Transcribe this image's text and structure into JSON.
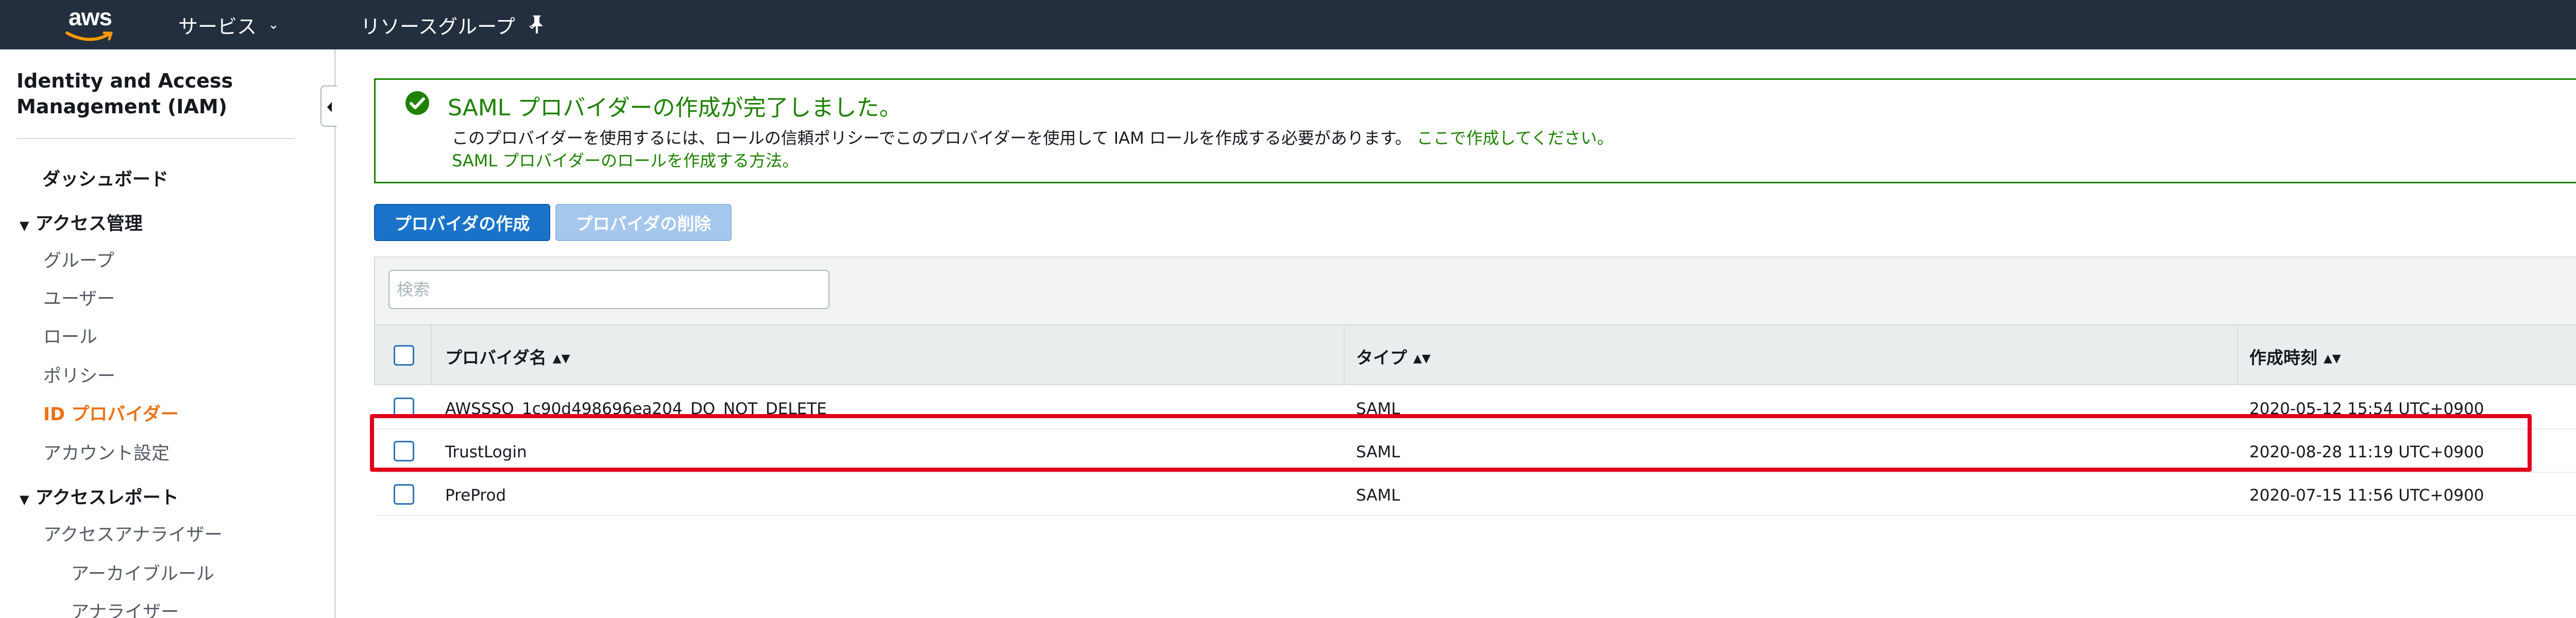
{
  "topbar": {
    "logo_text": "aws",
    "nav": [
      {
        "label": "サービス"
      },
      {
        "label": "リソースグループ"
      }
    ]
  },
  "sidebar": {
    "title": "Identity and Access Management (IAM)",
    "items": [
      {
        "label": "ダッシュボード"
      },
      {
        "label": "アクセス管理"
      },
      {
        "label": "グループ"
      },
      {
        "label": "ユーザー"
      },
      {
        "label": "ロール"
      },
      {
        "label": "ポリシー"
      },
      {
        "label": "ID プロバイダー"
      },
      {
        "label": "アカウント設定"
      },
      {
        "label": "アクセスレポート"
      },
      {
        "label": "アクセスアナライザー"
      },
      {
        "label": "アーカイブルール"
      },
      {
        "label": "アナライザー"
      }
    ]
  },
  "flash": {
    "title": "SAML プロバイダーの作成が完了しました。",
    "message": "このプロバイダーを使用するには、ロールの信頼ポリシーでこのプロバイダーを使用して IAM ロールを作成する必要があります。",
    "link_here": "ここで作成してください。",
    "link_howto": "SAML プロバイダーのロールを作成する方法。"
  },
  "buttons": {
    "create": "プロバイダの作成",
    "delete": "プロバイダの削除"
  },
  "table": {
    "search_placeholder": "検索",
    "columns": [
      "プロバイダ名",
      "タイプ",
      "作成時刻"
    ],
    "rows": [
      {
        "name": "AWSSSO_1c90d498696ea204_DO_NOT_DELETE",
        "type": "SAML",
        "created": "2020-05-12 15:54 UTC+0900"
      },
      {
        "name": "TrustLogin",
        "type": "SAML",
        "created": "2020-08-28 11:19 UTC+0900"
      },
      {
        "name": "PreProd",
        "type": "SAML",
        "created": "2020-07-15 11:56 UTC+0900"
      }
    ]
  },
  "colors": {
    "topbar": "#232f3e",
    "success": "#1d8102",
    "primary_button": "#1a73c9",
    "active_nav": "#ec7211",
    "highlight": "#e0001b"
  }
}
